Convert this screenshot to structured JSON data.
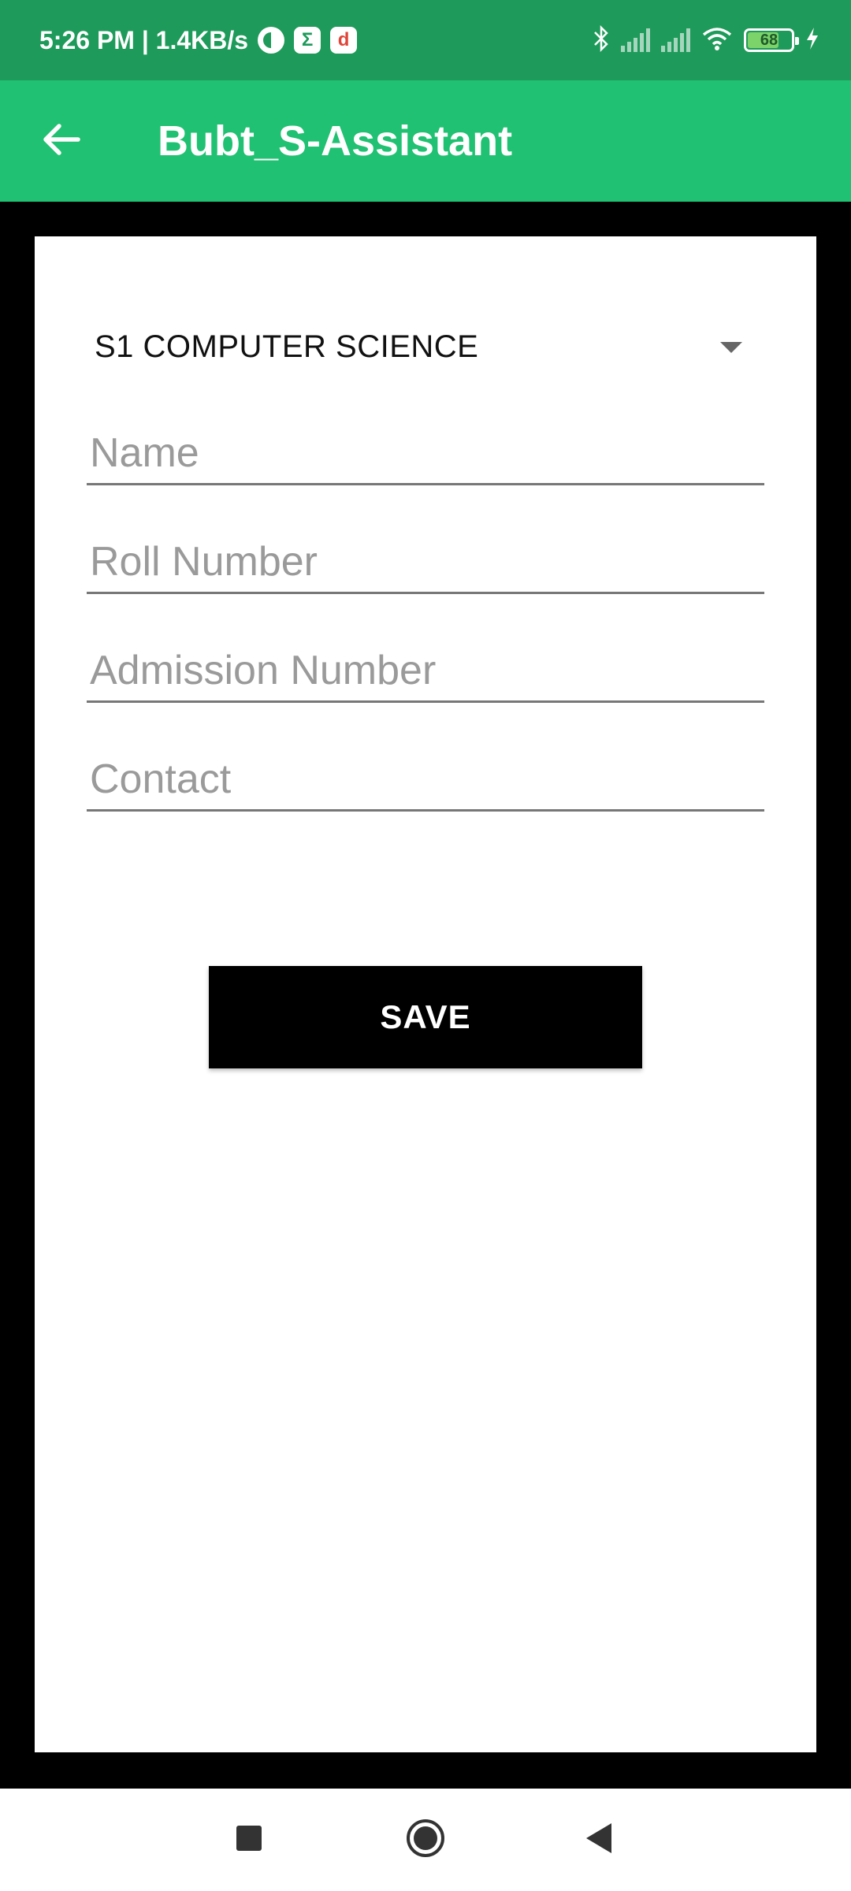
{
  "status_bar": {
    "time_speed": "5:26 PM | 1.4KB/s",
    "battery_level": "68",
    "battery_fraction": 0.68,
    "icons": [
      "app-c-icon",
      "sigma-app-icon",
      "d-app-icon",
      "bluetooth-icon",
      "signal-icon",
      "signal-icon",
      "wifi-icon",
      "battery-icon",
      "charging-icon"
    ]
  },
  "app_bar": {
    "title": "Bubt_S-Assistant",
    "back_icon": "arrow-left-icon"
  },
  "form": {
    "class_selected": "S1 COMPUTER SCIENCE",
    "name_placeholder": "Name",
    "roll_placeholder": "Roll Number",
    "admission_placeholder": "Admission Number",
    "contact_placeholder": "Contact",
    "save_label": "SAVE"
  },
  "nav_bar": {
    "icons": [
      "square-recents-icon",
      "circle-home-icon",
      "triangle-back-icon"
    ]
  },
  "colors": {
    "status_bar": "#1e9a5a",
    "app_bar": "#20c172",
    "button": "#000000"
  }
}
